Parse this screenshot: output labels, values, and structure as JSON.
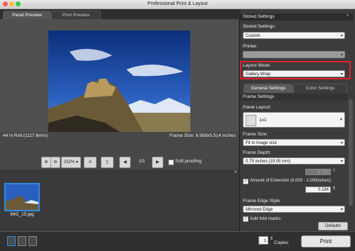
{
  "window": {
    "title": "Professional Print & Layout"
  },
  "tabs": [
    {
      "label": "Panel Preview"
    },
    {
      "label": "Print Preview"
    }
  ],
  "info": {
    "left": "44 in Roll (1117.6mm)",
    "right": "Frame Size: 6.958x5.514 inches"
  },
  "toolbar": {
    "zoom": "232%",
    "page": "1/1",
    "soft_proofing": "Soft proofing"
  },
  "thumbnail": {
    "filename": "IMG_15.jpg"
  },
  "bottom": {
    "copies_value": "1",
    "copies_label": "Copies",
    "print_label": "Print"
  },
  "stored_settings": {
    "section_title": "Stored Settings",
    "label": "Stored Settings:",
    "value": "Custom",
    "printer_label": "Printer:",
    "printer_value": "",
    "layout_mode_label": "Layout Mode:",
    "layout_mode_value": "Gallery Wrap"
  },
  "settings_tabs": [
    {
      "label": "General Settings"
    },
    {
      "label": "Color Settings"
    }
  ],
  "frame_settings": {
    "section_title": "Frame Settings",
    "panel_layout_label": "Panel Layout:",
    "panel_layout_value": "1x1",
    "frame_size_label": "Frame Size:",
    "frame_size_value": "Fit to image size",
    "frame_depth_label": "Frame Depth:",
    "frame_depth_value": "0.75 inches (19.05 mm)",
    "frame_depth_number": "0.750",
    "extension_label": "Amount of Extension (0.000 - 1.000inches):",
    "extension_value": "0.194",
    "edge_style_label": "Frame Edge Style:",
    "edge_style_value": "Mirrored Edge",
    "fold_marks_label": "Add fold marks",
    "defaults_label": "Defaults"
  },
  "colors": {
    "accent": "#2f8de4",
    "highlight": "#e0202a"
  }
}
